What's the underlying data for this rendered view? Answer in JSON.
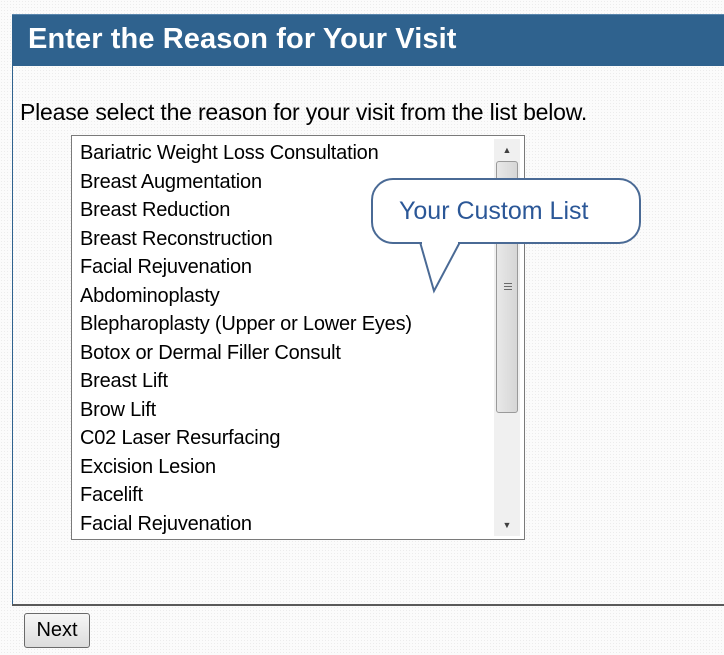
{
  "header": {
    "title": "Enter the Reason for Your Visit"
  },
  "instruction": "Please select the reason for your visit from the list below.",
  "reason_list": {
    "items": [
      "Bariatric Weight Loss Consultation",
      "Breast Augmentation",
      "Breast Reduction",
      "Breast Reconstruction",
      "Facial Rejuvenation",
      "Abdominoplasty",
      "Blepharoplasty (Upper or Lower Eyes)",
      "Botox or Dermal Filler Consult",
      "Breast Lift",
      "Brow Lift",
      "C02 Laser Resurfacing",
      "Excision Lesion",
      "Facelift",
      "Facial Rejuvenation"
    ]
  },
  "callout": {
    "text": "Your Custom List"
  },
  "footer": {
    "next_label": "Next"
  },
  "colors": {
    "header_bg": "#2f628e",
    "header_text": "#ffffff",
    "callout_border": "#4a6a95",
    "callout_text": "#2b5797"
  },
  "icons": {
    "scroll_up": "scroll-up-arrow-icon",
    "scroll_down": "scroll-down-arrow-icon",
    "scroll_grip": "scroll-grip-icon"
  }
}
